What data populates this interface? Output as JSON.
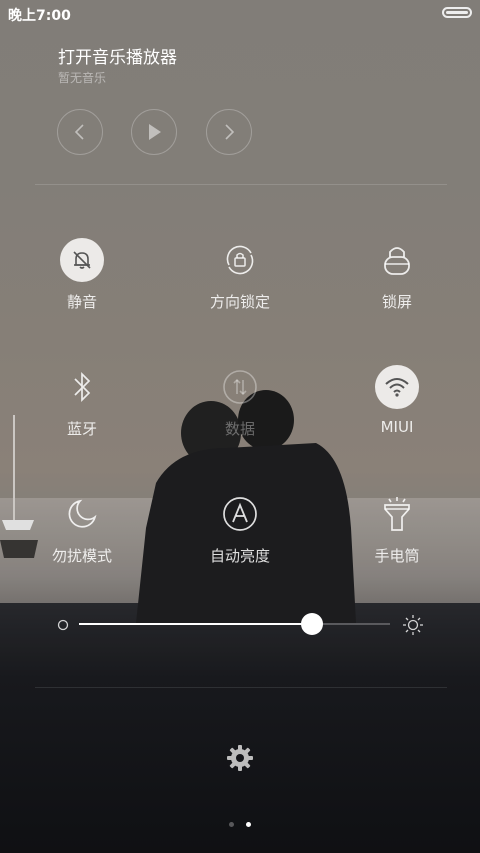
{
  "status_bar": {
    "time": "晚上7:00"
  },
  "music": {
    "title": "打开音乐播放器",
    "subtitle": "暂无音乐",
    "controls": [
      "previous-icon",
      "play-icon",
      "next-icon"
    ]
  },
  "toggles": [
    {
      "label": "静音",
      "icon": "silent-bell-icon",
      "state": "on"
    },
    {
      "label": "方向锁定",
      "icon": "rotation-lock-icon",
      "state": "off"
    },
    {
      "label": "锁屏",
      "icon": "lock-icon",
      "state": "off"
    },
    {
      "label": "蓝牙",
      "icon": "bluetooth-icon",
      "state": "off"
    },
    {
      "label": "数据",
      "icon": "mobile-data-icon",
      "state": "disabled"
    },
    {
      "label": "MIUI",
      "icon": "wifi-icon",
      "state": "on"
    },
    {
      "label": "勿扰模式",
      "icon": "moon-icon",
      "state": "off"
    },
    {
      "label": "自动亮度",
      "icon": "auto-brightness-icon",
      "state": "off"
    },
    {
      "label": "手电筒",
      "icon": "flashlight-icon",
      "state": "off"
    }
  ],
  "brightness": {
    "level": 0.75
  },
  "pager": {
    "pages": 2,
    "current": 2
  },
  "colors": {
    "toggle_on_bg": "#eceae8",
    "toggle_on_icon": "#555555"
  }
}
